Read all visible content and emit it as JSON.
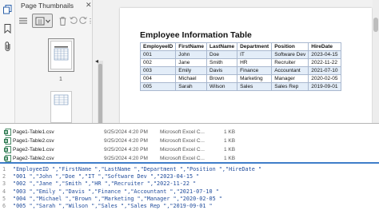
{
  "viewer": {
    "panel_title": "Page Thumbnails",
    "thumbnail_page_label": "1",
    "collapse_glyph": "◂",
    "icons": [
      "pages-icon",
      "bookmark-icon",
      "attachment-icon",
      "close-icon",
      "menu-icon",
      "thumbnail-view-icon",
      "delete-icon",
      "undo-icon",
      "redo-icon",
      "more-options-icon"
    ],
    "page": {
      "title": "Employee Information Table",
      "table": {
        "headers": [
          "EmployeeID",
          "FirstName",
          "LastName",
          "Department",
          "Position",
          "HireDate"
        ],
        "rows": [
          [
            "001",
            "John",
            "Doe",
            "IT",
            "Software Dev",
            "2023-04-15"
          ],
          [
            "002",
            "Jane",
            "Smith",
            "HR",
            "Recruiter",
            "2022-11-22"
          ],
          [
            "003",
            "Emily",
            "Davis",
            "Finance",
            "Accountant",
            "2021-07-10"
          ],
          [
            "004",
            "Michael",
            "Brown",
            "Marketing",
            "Manager",
            "2020-02-05"
          ],
          [
            "005",
            "Sarah",
            "Wilson",
            "Sales",
            "Sales Rep",
            "2019-09-01"
          ]
        ]
      }
    }
  },
  "files": [
    {
      "name": "Page1-Table1.csv",
      "date": "9/25/2024 4:20 PM",
      "type": "Microsoft Excel C...",
      "size": "1 KB",
      "icon": "csv-file-icon"
    },
    {
      "name": "Page1-Table2.csv",
      "date": "9/25/2024 4:20 PM",
      "type": "Microsoft Excel C...",
      "size": "1 KB",
      "icon": "csv-file-icon"
    },
    {
      "name": "Page2-Table1.csv",
      "date": "9/25/2024 4:20 PM",
      "type": "Microsoft Excel C...",
      "size": "1 KB",
      "icon": "csv-file-icon"
    },
    {
      "name": "Page2-Table2.csv",
      "date": "9/25/2024 4:20 PM",
      "type": "Microsoft Excel C...",
      "size": "1 KB",
      "icon": "csv-file-icon"
    }
  ],
  "csv_lines": [
    {
      "n": "1",
      "text": "\"EmployeeID \",\"FirstName \",\"LastName \",\"Department \",\"Position \",\"HireDate \""
    },
    {
      "n": "2",
      "text": "\"001 \",\"John \",\"Doe \",\"IT \",\"Software Dev \",\"2023-04-15 \""
    },
    {
      "n": "3",
      "text": "\"002 \",\"Jane \",\"Smith \",\"HR \",\"Recruiter \",\"2022-11-22 \""
    },
    {
      "n": "4",
      "text": "\"003 \",\"Emily \",\"Davis \",\"Finance \",\"Accountant \",\"2021-07-10 \""
    },
    {
      "n": "5",
      "text": "\"004 \",\"Michael \",\"Brown \",\"Marketing \",\"Manager \",\"2020-02-05 \""
    },
    {
      "n": "6",
      "text": "\"005 \",\"Sarah \",\"Wilson \",\"Sales \",\"Sales Rep \",\"2019-09-01 \""
    }
  ],
  "colors": {
    "accent": "#3f7ec9",
    "table_border": "#a9b8cf",
    "row_highlight": "#e3edf8",
    "csv_text": "#1f4b9b",
    "csv_icon": "#1d7044"
  }
}
